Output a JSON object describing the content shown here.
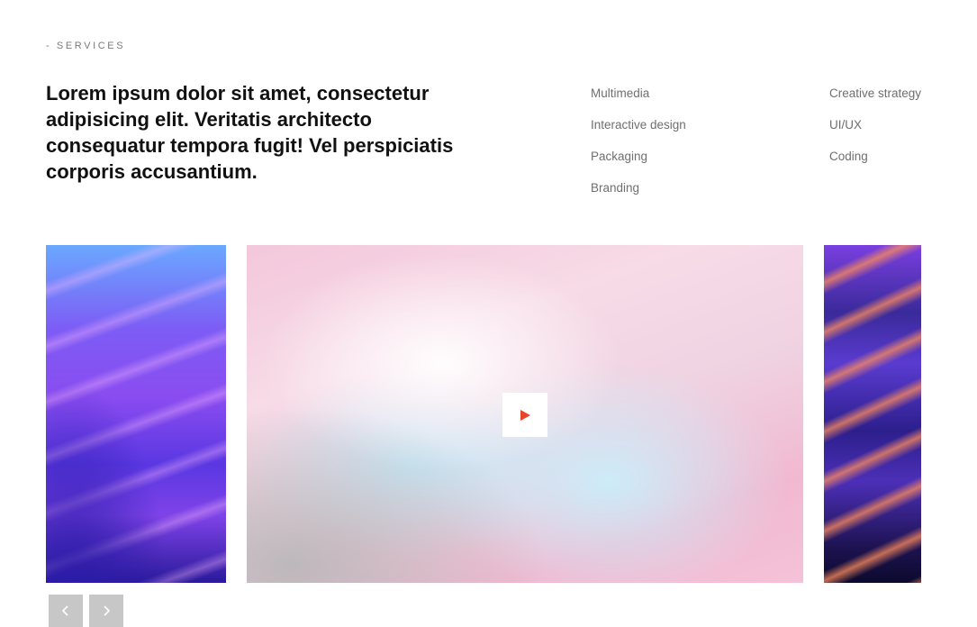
{
  "section": {
    "eyebrow": "- SERVICES",
    "headline": "Lorem ipsum dolor sit amet, consectetur adipisicing elit. Veritatis architecto consequatur tempora fugit! Vel perspiciatis corporis accusantium."
  },
  "services": {
    "column_1": [
      "Multimedia",
      "Interactive design",
      "Packaging",
      "Branding"
    ],
    "column_2": [
      "Creative strategy",
      "UI/UX",
      "Coding"
    ]
  },
  "carousel": {
    "play_icon": "play-icon",
    "prev_icon": "chevron-left-icon",
    "next_icon": "chevron-right-icon"
  },
  "colors": {
    "play_accent": "#e8432b",
    "nav_background": "#c7c7c7",
    "text_primary": "#111111",
    "text_secondary": "#6f6f6f"
  }
}
